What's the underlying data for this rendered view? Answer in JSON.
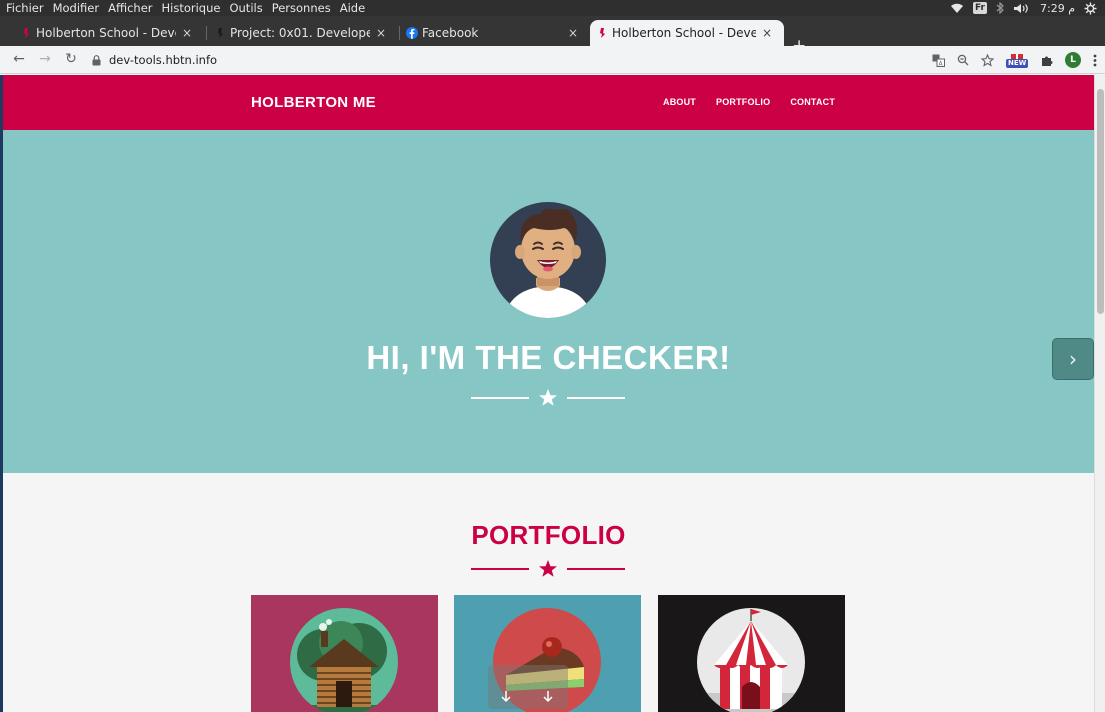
{
  "os_bar": {
    "menu": [
      "Fichier",
      "Modifier",
      "Afficher",
      "Historique",
      "Outils",
      "Personnes",
      "Aide"
    ],
    "lang_badge": "Fr",
    "clock": "7:29 م"
  },
  "tabs": [
    {
      "title": "Holberton School - Develo",
      "close": "×"
    },
    {
      "title": "Project: 0x01. Developer t",
      "close": "×"
    },
    {
      "title": "Facebook",
      "close": "×"
    },
    {
      "title": "Holberton School - Develo",
      "close": "×"
    }
  ],
  "new_tab_label": "+",
  "toolbar": {
    "url": "dev-tools.hbtn.info",
    "new_badge": "NEW",
    "profile_initial": "L"
  },
  "site": {
    "brand": "HOLBERTON ME",
    "nav": [
      "ABOUT",
      "PORTFOLIO",
      "CONTACT"
    ],
    "hero_title": "HI, I'M THE CHECKER!",
    "portfolio_title": "PORTFOLIO"
  },
  "colors": {
    "brand": "#cc0044",
    "hero_bg": "#86c7c6",
    "card1": "#a8365f",
    "card2": "#4ea0b0",
    "card3": "#1a1718"
  }
}
